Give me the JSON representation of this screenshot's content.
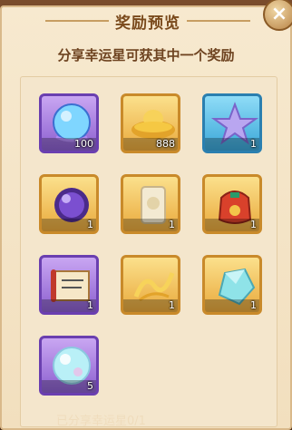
{
  "dialog": {
    "title": "奖励预览",
    "subtitle": "分享幸运星可获其中一个奖励",
    "close_label": "×",
    "background_hint": "已分享幸运星0/1"
  },
  "rewards": [
    {
      "icon": "crystal-orb-icon",
      "count": "100",
      "frame": "purple"
    },
    {
      "icon": "gold-ingot-icon",
      "count": "888",
      "frame": "gold"
    },
    {
      "icon": "lucky-star-icon",
      "count": "1",
      "frame": "blue"
    },
    {
      "icon": "purple-orb-icon",
      "count": "1",
      "frame": "gold"
    },
    {
      "icon": "scroll-card-icon",
      "count": "1",
      "frame": "gold"
    },
    {
      "icon": "lucky-bag-icon",
      "count": "1",
      "frame": "gold"
    },
    {
      "icon": "scroll-icon",
      "count": "1",
      "frame": "purple"
    },
    {
      "icon": "golden-wind-icon",
      "count": "1",
      "frame": "gold"
    },
    {
      "icon": "crystal-gem-icon",
      "count": "1",
      "frame": "gold"
    },
    {
      "icon": "bubble-orb-icon",
      "count": "5",
      "frame": "purple"
    }
  ],
  "colors": {
    "panel": "#f2dfbe",
    "title_text": "#7a4a1c",
    "gold_frame": "#c98a2a",
    "purple_frame": "#6a3fb0",
    "blue_frame": "#2a7fb0"
  }
}
